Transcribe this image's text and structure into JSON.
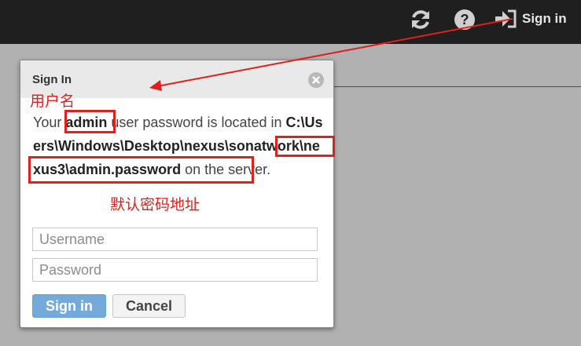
{
  "topbar": {
    "refresh_icon": "refresh-icon",
    "help_icon": "help-icon",
    "signin_label": "Sign in"
  },
  "dialog": {
    "title": "Sign In",
    "message": {
      "part1": "Your ",
      "username": "admin",
      "part2": " user password is located in ",
      "path": "C:\\Users\\Windows\\Desktop\\nexus\\sonatwork\\nexus3\\admin.password",
      "part3": " on the server."
    },
    "username_placeholder": "Username",
    "password_placeholder": "Password",
    "signin_button": "Sign in",
    "cancel_button": "Cancel"
  },
  "annotations": {
    "username_label": "用户名",
    "password_path_label": "默认密码地址",
    "color": "#e0201c"
  }
}
